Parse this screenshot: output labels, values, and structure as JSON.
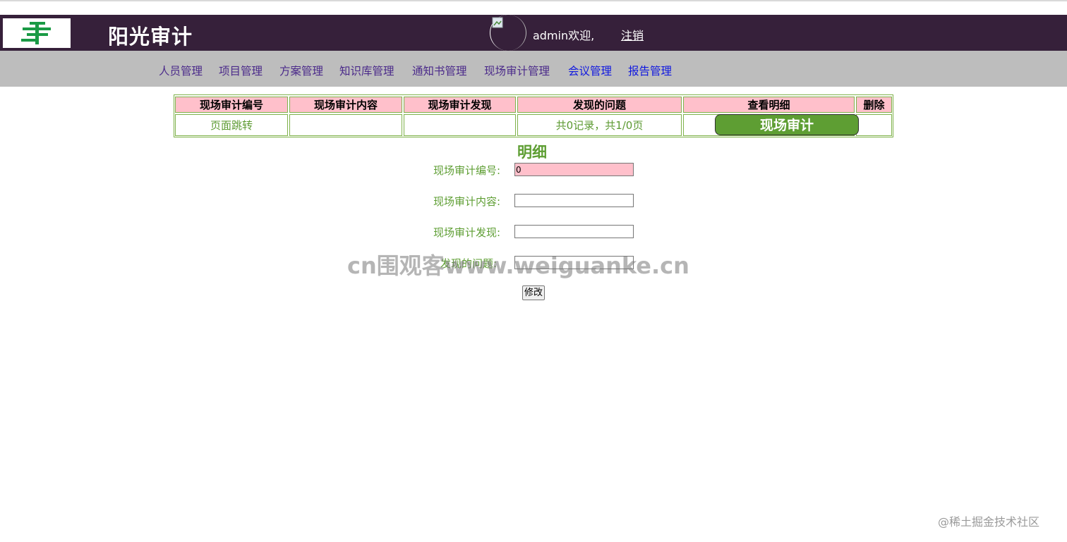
{
  "app": {
    "title": "阳光审计",
    "welcome": "admin欢迎,",
    "logout_label": "注销"
  },
  "nav": {
    "items": [
      "人员管理",
      "项目管理",
      "方案管理",
      "知识库管理",
      "通知书管理",
      "现场审计管理",
      "会议管理",
      "报告管理"
    ]
  },
  "table": {
    "headers": [
      "现场审计编号",
      "现场审计内容",
      "现场审计发现",
      "发现的问题",
      "查看明细",
      "删除"
    ],
    "row": {
      "page_jump": "页面跳转",
      "pager_text": "共0记录，共1/0页",
      "action_button": "现场审计"
    }
  },
  "detail": {
    "title": "明细",
    "fields": [
      {
        "label": "现场审计编号:",
        "value": "0"
      },
      {
        "label": "现场审计内容:",
        "value": ""
      },
      {
        "label": "现场审计发现:",
        "value": ""
      },
      {
        "label": "发现的问题:",
        "value": ""
      }
    ],
    "submit_label": "修改"
  },
  "overlays": {
    "watermark": "cn围观客www.weiguanke.cn",
    "credit": "@稀土掘金技术社区"
  },
  "colors": {
    "header_bg": "#36203a",
    "nav_bg": "#bdbdbd",
    "table_header_bg": "#ffc0cb",
    "accent_green": "#5e9e33",
    "border_green": "#7fb24b"
  }
}
